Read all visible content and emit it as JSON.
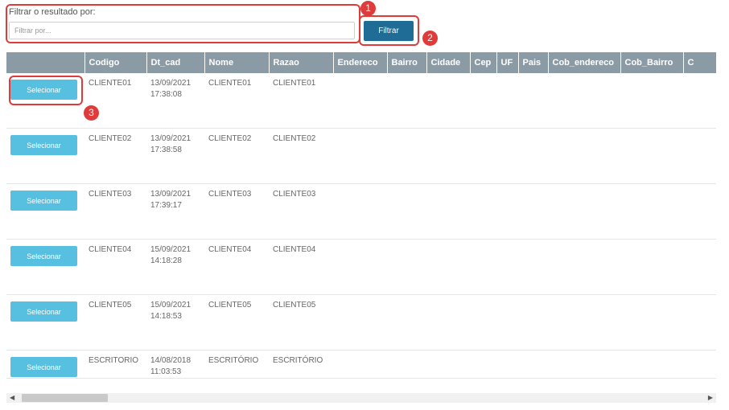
{
  "filter": {
    "label": "Filtrar o resultado por:",
    "placeholder": "Filtrar por...",
    "value": "",
    "button_label": "Filtrar"
  },
  "annotations": {
    "badge1": "1",
    "badge2": "2",
    "badge3": "3",
    "color": "#e03b3b"
  },
  "table": {
    "columns": [
      "",
      "Codigo",
      "Dt_cad",
      "Nome",
      "Razao",
      "Endereco",
      "Bairro",
      "Cidade",
      "Cep",
      "UF",
      "Pais",
      "Cob_endereco",
      "Cob_Bairro",
      "C"
    ],
    "rows": [
      {
        "button": "Selecionar",
        "codigo": "CLIENTE01",
        "dt_date": "13/09/2021",
        "dt_time": "17:38:08",
        "nome": "CLIENTE01",
        "razao": "CLIENTE01"
      },
      {
        "button": "Selecionar",
        "codigo": "CLIENTE02",
        "dt_date": "13/09/2021",
        "dt_time": "17:38:58",
        "nome": "CLIENTE02",
        "razao": "CLIENTE02"
      },
      {
        "button": "Selecionar",
        "codigo": "CLIENTE03",
        "dt_date": "13/09/2021",
        "dt_time": "17:39:17",
        "nome": "CLIENTE03",
        "razao": "CLIENTE03"
      },
      {
        "button": "Selecionar",
        "codigo": "CLIENTE04",
        "dt_date": "15/09/2021",
        "dt_time": "14:18:28",
        "nome": "CLIENTE04",
        "razao": "CLIENTE04"
      },
      {
        "button": "Selecionar",
        "codigo": "CLIENTE05",
        "dt_date": "15/09/2021",
        "dt_time": "14:18:53",
        "nome": "CLIENTE05",
        "razao": "CLIENTE05"
      },
      {
        "button": "Selecionar",
        "codigo": "ESCRITORIO",
        "dt_date": "14/08/2018",
        "dt_time": "11:03:53",
        "nome": "ESCRITÓRIO",
        "razao": "ESCRITÓRIO"
      }
    ]
  },
  "colors": {
    "header_bg": "#8a9ba6",
    "filter_button": "#1f6d97",
    "select_button": "#57bfe0"
  },
  "scrollbar": {
    "left_icon": "arrow-left-icon",
    "right_icon": "arrow-right-icon",
    "left_glyph": "◀",
    "right_glyph": "▶"
  }
}
